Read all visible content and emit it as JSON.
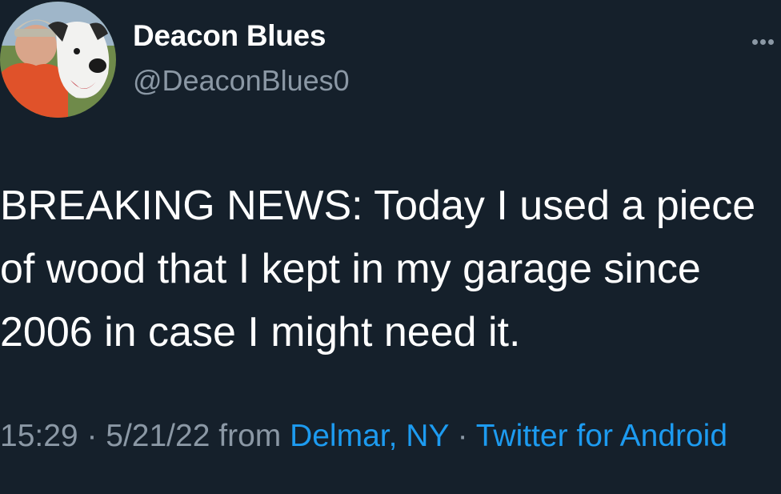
{
  "user": {
    "display_name": "Deacon Blues",
    "handle": "@DeaconBlues0",
    "avatar_icon": "profile-photo-man-with-dog"
  },
  "menu": {
    "icon": "more-horizontal-icon"
  },
  "tweet": {
    "text": "BREAKING NEWS: Today I used a piece of wood that I kept in my garage since 2006 in case I might need it."
  },
  "meta": {
    "time": "15:29",
    "sep1": " · ",
    "date": "5/21/22",
    "from": " from ",
    "location": "Delmar, NY",
    "sep2": " · ",
    "source": "Twitter for Android"
  },
  "colors": {
    "background": "#15202b",
    "secondary_text": "#8b98a5",
    "link": "#1d9bf0"
  }
}
